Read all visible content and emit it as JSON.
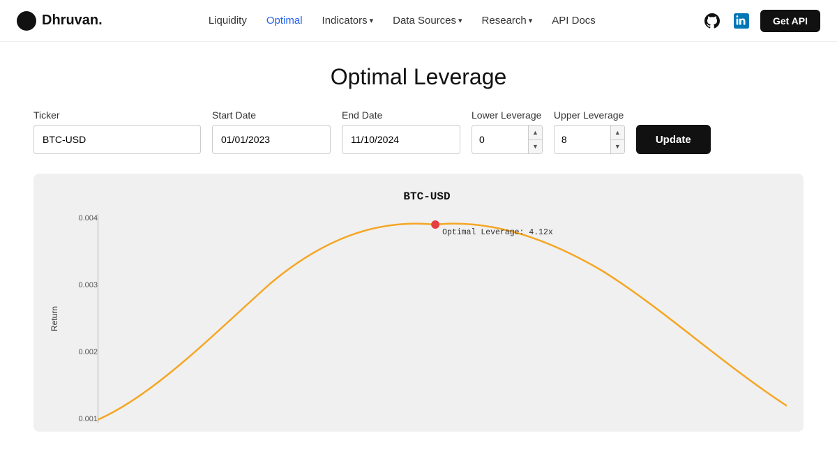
{
  "logo": {
    "name": "Dhruvan.",
    "dot_color": "#111"
  },
  "nav": {
    "links": [
      {
        "id": "liquidity",
        "label": "Liquidity",
        "active": false
      },
      {
        "id": "optimal",
        "label": "Optimal",
        "active": true
      },
      {
        "id": "indicators",
        "label": "Indicators",
        "dropdown": true
      },
      {
        "id": "data-sources",
        "label": "Data Sources",
        "dropdown": true
      },
      {
        "id": "research",
        "label": "Research",
        "dropdown": true
      },
      {
        "id": "api-docs",
        "label": "API Docs",
        "active": false
      }
    ],
    "get_api_label": "Get API"
  },
  "page": {
    "title": "Optimal Leverage"
  },
  "controls": {
    "ticker_label": "Ticker",
    "ticker_value": "BTC-USD",
    "start_date_label": "Start Date",
    "start_date_value": "01/01/2023",
    "end_date_label": "End Date",
    "end_date_value": "11/10/2024",
    "lower_leverage_label": "Lower Leverage",
    "lower_leverage_value": "0",
    "upper_leverage_label": "Upper Leverage",
    "upper_leverage_value": "8",
    "update_label": "Update"
  },
  "chart": {
    "title": "BTC-USD",
    "y_axis_label": "Return",
    "y_ticks": [
      "0.004",
      "0.003",
      "0.002",
      "0.001"
    ],
    "optimal_label": "Optimal Leverage: 4.12x",
    "accent_color": "#f5a623",
    "optimal_dot_color": "#e53e3e"
  }
}
